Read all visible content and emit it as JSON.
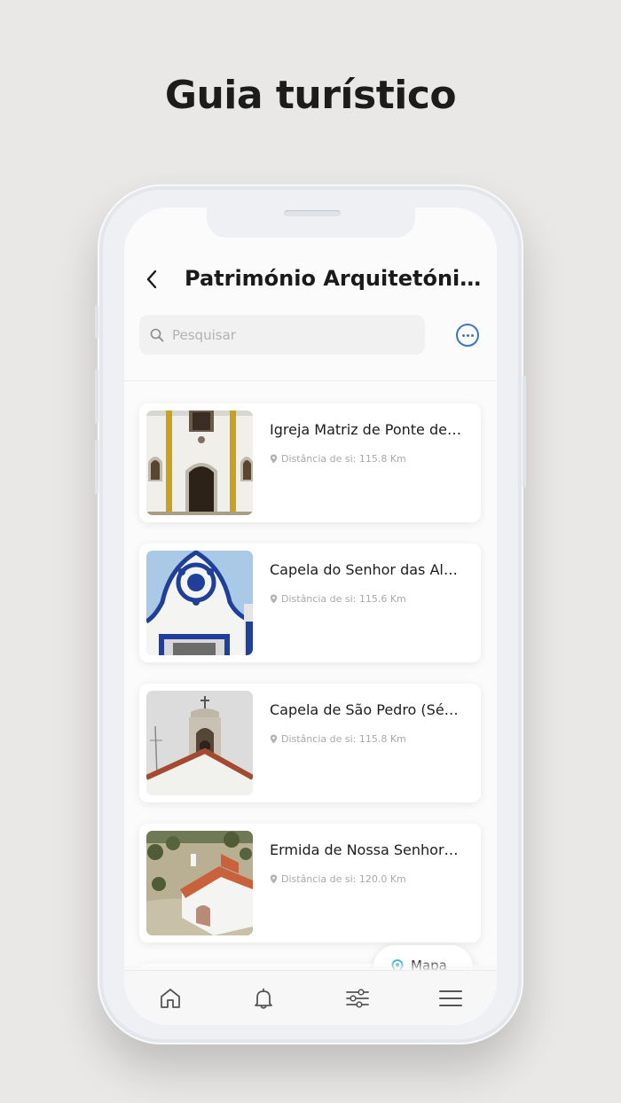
{
  "promo": {
    "title": "Guia turístico"
  },
  "header": {
    "title": "Património Arquitetónic…"
  },
  "search": {
    "placeholder": "Pesquisar",
    "value": ""
  },
  "places": [
    {
      "name": "Igreja Matriz de Ponte de …",
      "distance": "Distância de si: 115.8 Km",
      "image": "white-church-facade"
    },
    {
      "name": "Capela do Senhor das Al…",
      "distance": "Distância de si: 115.6 Km",
      "image": "blue-trim-chapel"
    },
    {
      "name": "Capela de São Pedro (Sé…",
      "distance": "Distância de si: 115.8 Km",
      "image": "bell-tower-chapel"
    },
    {
      "name": "Ermida de Nossa Senhor…",
      "distance": "Distância de si: 120.0 Km",
      "image": "aerial-hermitage"
    }
  ],
  "map_button": {
    "label": "Mapa",
    "icon": "map-pin-icon"
  },
  "tabbar": {
    "items": [
      {
        "icon": "home-icon"
      },
      {
        "icon": "bell-icon"
      },
      {
        "icon": "filters-icon"
      },
      {
        "icon": "menu-icon"
      }
    ]
  },
  "colors": {
    "accent": "#3a76c9",
    "background": "#e9e8e6",
    "map_pin": "#3ab0d6"
  }
}
